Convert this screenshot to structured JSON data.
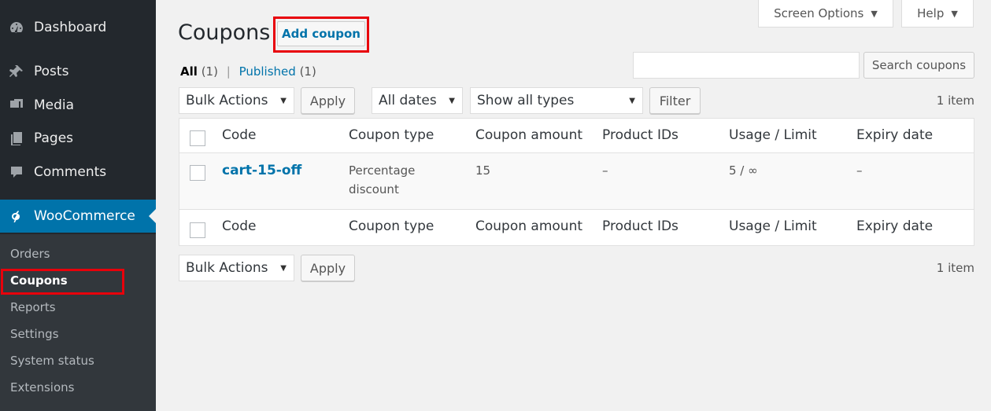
{
  "sidebar": {
    "items": [
      {
        "label": "Dashboard",
        "icon": "dashboard-icon"
      },
      {
        "label": "Posts",
        "icon": "pin-icon"
      },
      {
        "label": "Media",
        "icon": "media-icon"
      },
      {
        "label": "Pages",
        "icon": "pages-icon"
      },
      {
        "label": "Comments",
        "icon": "comment-icon"
      },
      {
        "label": "WooCommerce",
        "icon": "woocommerce-icon"
      }
    ],
    "submenu": [
      "Orders",
      "Coupons",
      "Reports",
      "Settings",
      "System status",
      "Extensions"
    ],
    "current_submenu": "Coupons"
  },
  "header": {
    "screen_options": "Screen Options",
    "help": "Help"
  },
  "page": {
    "title": "Coupons",
    "add_button": "Add coupon"
  },
  "views": {
    "all": "All",
    "all_count": "(1)",
    "separator": "|",
    "published": "Published",
    "published_count": "(1)"
  },
  "search": {
    "value": "",
    "button": "Search coupons"
  },
  "tablenav_top": {
    "bulk_actions": "Bulk Actions",
    "apply": "Apply",
    "dates": "All dates",
    "types": "Show all types",
    "filter": "Filter",
    "count": "1 item"
  },
  "tablenav_bottom": {
    "bulk_actions": "Bulk Actions",
    "apply": "Apply",
    "count": "1 item"
  },
  "table": {
    "columns": [
      "Code",
      "Coupon type",
      "Coupon amount",
      "Product IDs",
      "Usage / Limit",
      "Expiry date"
    ],
    "rows": [
      {
        "code": "cart-15-off",
        "type_line1": "Percentage",
        "type_line2": "discount",
        "amount": "15",
        "product_ids": "–",
        "usage": "5 / ∞",
        "expiry": "–"
      }
    ]
  },
  "colors": {
    "sidebar_bg": "#23282d",
    "submenu_bg": "#32373c",
    "accent": "#0073aa",
    "highlight": "#e8000b"
  }
}
